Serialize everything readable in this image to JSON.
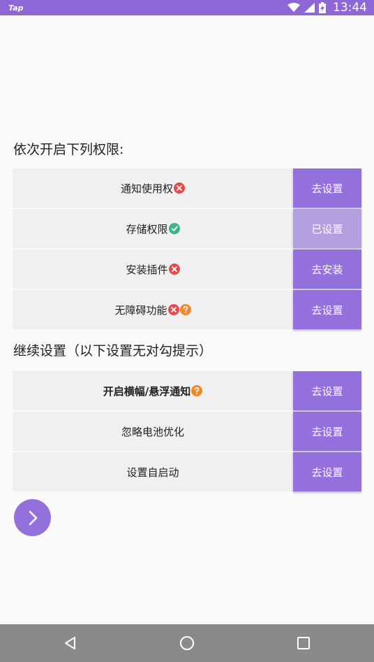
{
  "status_bar": {
    "app_label": "Tap",
    "time": "13:44"
  },
  "section1": {
    "title": "依次开启下列权限:",
    "rows": [
      {
        "label": "通知使用权",
        "button": "去设置",
        "badges": [
          "cross-icon"
        ]
      },
      {
        "label": "存储权限",
        "button": "已设置",
        "badges": [
          "check-icon"
        ]
      },
      {
        "label": "安装插件",
        "button": "去安装",
        "badges": [
          "cross-icon"
        ]
      },
      {
        "label": "无障碍功能",
        "button": "去设置",
        "badges": [
          "cross-icon",
          "question-icon"
        ]
      }
    ]
  },
  "section2": {
    "title": "继续设置（以下设置无对勾提示）",
    "rows": [
      {
        "label": "开启横幅/悬浮通知",
        "button": "去设置",
        "badges": [
          "question-icon"
        ]
      },
      {
        "label": "忽略电池优化",
        "button": "去设置",
        "badges": []
      },
      {
        "label": "设置自启动",
        "button": "去设置",
        "badges": []
      }
    ]
  },
  "colors": {
    "accent": "#9370db",
    "accent_done": "#b3a0de",
    "status_bar": "#8e67d6",
    "nav_bar": "#8a8a8a",
    "row_bg": "#f0f0f0",
    "error": "#e64a4a",
    "success": "#3cb38a",
    "help": "#f0882a"
  },
  "nav_icons": [
    "back-icon",
    "home-icon",
    "recents-icon"
  ]
}
